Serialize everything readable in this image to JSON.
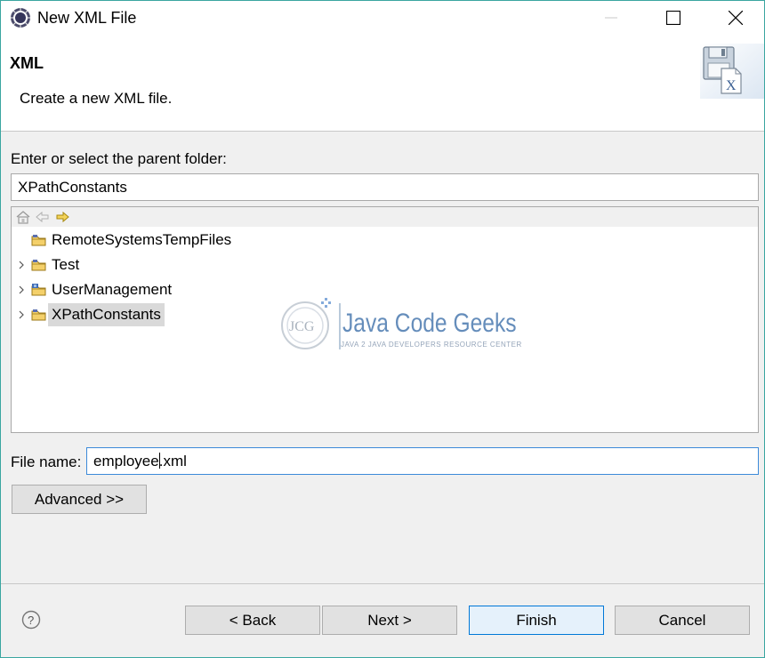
{
  "window": {
    "title": "New XML File",
    "controls": {
      "minimize": "minimize",
      "maximize": "maximize",
      "close": "close"
    }
  },
  "banner": {
    "title": "XML",
    "description": "Create a new XML file."
  },
  "folder_section": {
    "label": "Enter or select the parent folder:",
    "value": "XPathConstants"
  },
  "tree": {
    "toolbar": [
      "home-icon",
      "back-arrow-icon",
      "forward-arrow-icon"
    ],
    "items": [
      {
        "label": "RemoteSystemsTempFiles",
        "expandable": false,
        "selected": false,
        "icon": "project-folder-icon"
      },
      {
        "label": "Test",
        "expandable": true,
        "selected": false,
        "icon": "project-folder-icon"
      },
      {
        "label": "UserManagement",
        "expandable": true,
        "selected": false,
        "icon": "java-project-icon"
      },
      {
        "label": "XPathConstants",
        "expandable": true,
        "selected": true,
        "icon": "project-folder-icon"
      }
    ],
    "watermark": {
      "logo_text": "JCG",
      "name": "Java Code Geeks",
      "tagline": "JAVA 2 JAVA DEVELOPERS RESOURCE CENTER"
    }
  },
  "file_name": {
    "label": "File name:",
    "value_before_caret": "employee",
    "value_after_caret": ".xml"
  },
  "buttons": {
    "advanced": "Advanced >>",
    "back": "< Back",
    "next": "Next >",
    "finish": "Finish",
    "cancel": "Cancel"
  },
  "colors": {
    "window_border": "#3aa6a0",
    "dialog_bg": "#f0f0f0",
    "default_button_border": "#0078d7",
    "selection": "#d9d9d9"
  }
}
